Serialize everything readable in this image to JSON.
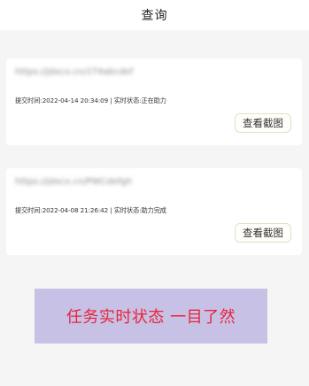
{
  "header": {
    "title": "查询"
  },
  "cards": [
    {
      "link_blurred": "https://jdxcx.cn/1T4abcdef",
      "submit_label": "提交时间:",
      "submit_time": "2022-04-14 20:34:09",
      "separator": " | ",
      "status_label": "实时状态:",
      "status_value": "正在助力",
      "view_button": "查看截图"
    },
    {
      "link_blurred": "https://jdxcx.cn/PWCdefgh",
      "submit_label": "提交时间:",
      "submit_time": "2022-04-08 21:26:42",
      "separator": " | ",
      "status_label": "实时状态:",
      "status_value": "助力完成",
      "view_button": "查看截图"
    }
  ],
  "banner": {
    "text": "任务实时状态 一目了然"
  }
}
